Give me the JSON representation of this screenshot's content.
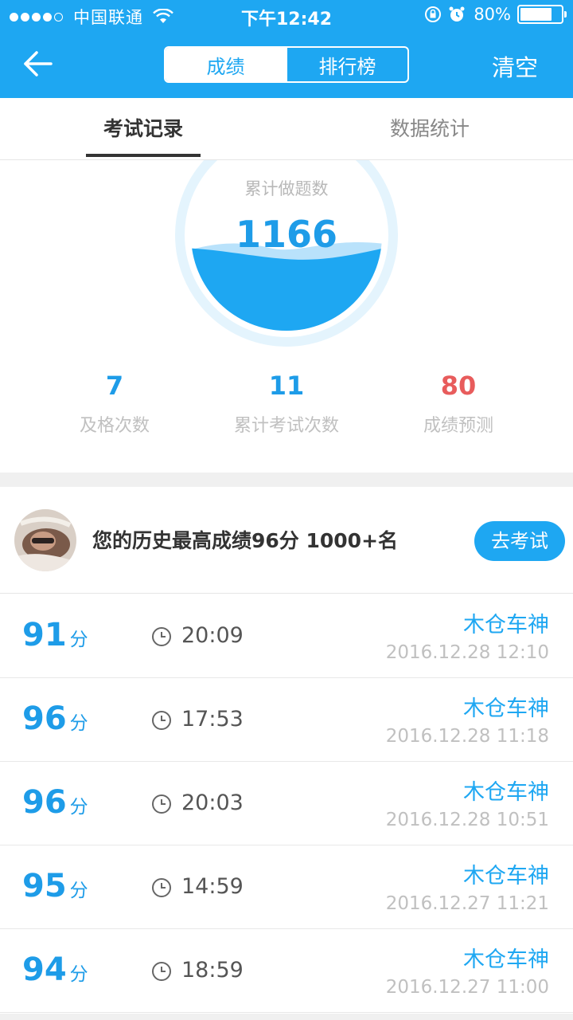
{
  "status_bar": {
    "carrier": "中国联通",
    "time": "下午12:42",
    "battery": "80%",
    "battery_level": 0.8
  },
  "nav": {
    "segments": [
      "成绩",
      "排行榜"
    ],
    "active_segment": 0,
    "clear_label": "清空",
    "back_icon": "back-arrow-icon"
  },
  "subtabs": {
    "items": [
      "考试记录",
      "数据统计"
    ],
    "active": 0
  },
  "gauge": {
    "label": "累计做题数",
    "value": "1166"
  },
  "stats": [
    {
      "value": "7",
      "label": "及格次数"
    },
    {
      "value": "11",
      "label": "累计考试次数"
    },
    {
      "value": "80",
      "label": "成绩预测"
    }
  ],
  "best": {
    "text": "您的历史最高成绩96分 1000+名",
    "button": "去考试"
  },
  "records": [
    {
      "score": "91",
      "unit": "分",
      "duration": "20:09",
      "name": "木仓车神",
      "date": "2016.12.28 12:10"
    },
    {
      "score": "96",
      "unit": "分",
      "duration": "17:53",
      "name": "木仓车神",
      "date": "2016.12.28 11:18"
    },
    {
      "score": "96",
      "unit": "分",
      "duration": "20:03",
      "name": "木仓车神",
      "date": "2016.12.28 10:51"
    },
    {
      "score": "95",
      "unit": "分",
      "duration": "14:59",
      "name": "木仓车神",
      "date": "2016.12.27 11:21"
    },
    {
      "score": "94",
      "unit": "分",
      "duration": "18:59",
      "name": "木仓车神",
      "date": "2016.12.27 11:00"
    }
  ],
  "colors": {
    "primary": "#1ea7f2",
    "score_blue": "#1e9ce8",
    "predict_red": "#e85c5c"
  }
}
